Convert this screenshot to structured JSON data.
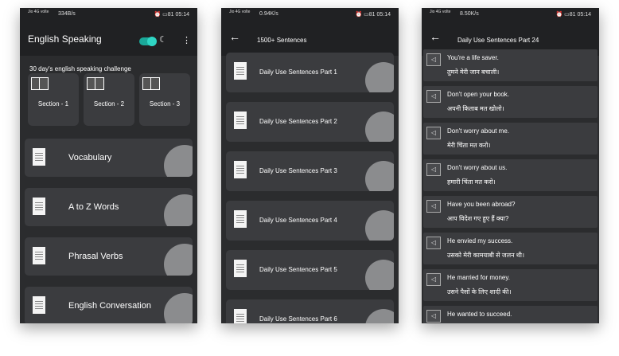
{
  "status": {
    "signal": "Jio 4G\nvolte",
    "speed1": "334B/s",
    "speed2": "0.94K/s",
    "speed3": "8.50K/s",
    "battery": "81",
    "time": "05:14"
  },
  "phone1": {
    "title": "English Speaking",
    "challenge": "30 day's english speaking challenge",
    "sections": [
      "Section - 1",
      "Section - 2",
      "Section - 3"
    ],
    "items": [
      "Vocabulary",
      "A to Z Words",
      "Phrasal Verbs",
      "English Conversation"
    ]
  },
  "phone2": {
    "title": "1500+ Sentences",
    "items": [
      "Daily Use Sentences Part 1",
      "Daily Use Sentences Part 2",
      "Daily Use Sentences Part 3",
      "Daily Use Sentences Part 4",
      "Daily Use Sentences Part 5",
      "Daily Use Sentences Part 6"
    ]
  },
  "phone3": {
    "title": "Daily Use Sentences Part 24",
    "sentences": [
      {
        "en": "You're a life saver.",
        "hi": "तुमने मेरी जान बचाली।"
      },
      {
        "en": "Don't open your book.",
        "hi": "अपनी किताब मत खोलो।"
      },
      {
        "en": "Don't worry about me.",
        "hi": "मेरी चिंता मत करो।"
      },
      {
        "en": "Don't worry about us.",
        "hi": "हमारी चिंता मत करो।"
      },
      {
        "en": "Have you been abroad?",
        "hi": "आप विदेश गए हुए हैं क्या?"
      },
      {
        "en": "He envied my success.",
        "hi": "उसको मेरी कामयाबी से जलन थी।"
      },
      {
        "en": "He married for money.",
        "hi": "उसने पैसों के लिए शादी की।"
      },
      {
        "en": "He wanted to succeed.",
        "hi": ""
      }
    ]
  },
  "icons": {
    "back": "back-arrow-icon",
    "menu": "kebab-menu-icon",
    "speaker": "speaker-icon",
    "document": "document-icon",
    "book": "book-icon"
  },
  "colors": {
    "accent": "#2fd6c4",
    "card": "#3b3c3f",
    "bg": "#2b2c2e"
  }
}
